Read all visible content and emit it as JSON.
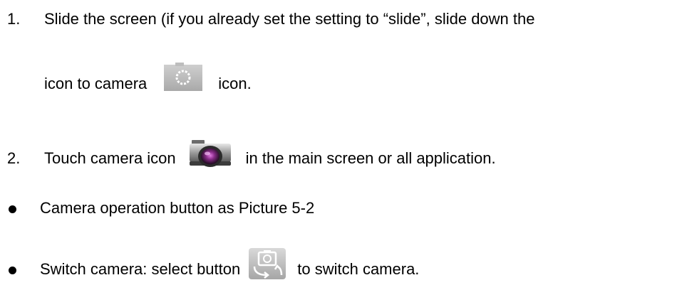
{
  "steps": [
    {
      "number": "1.",
      "line1": "Slide the screen (if you already set the setting to “slide”, slide down the",
      "line2_before": "icon to camera",
      "line2_after": "icon.",
      "icon": "camera-square-icon"
    },
    {
      "number": "2.",
      "before": "Touch camera icon",
      "after": "in the main screen or all application.",
      "icon": "camera-app-icon"
    }
  ],
  "bullets": [
    {
      "text": "Camera operation button as Picture 5-2"
    },
    {
      "before": "Switch camera: select button",
      "after": "to switch camera.",
      "icon": "switch-camera-icon"
    }
  ]
}
